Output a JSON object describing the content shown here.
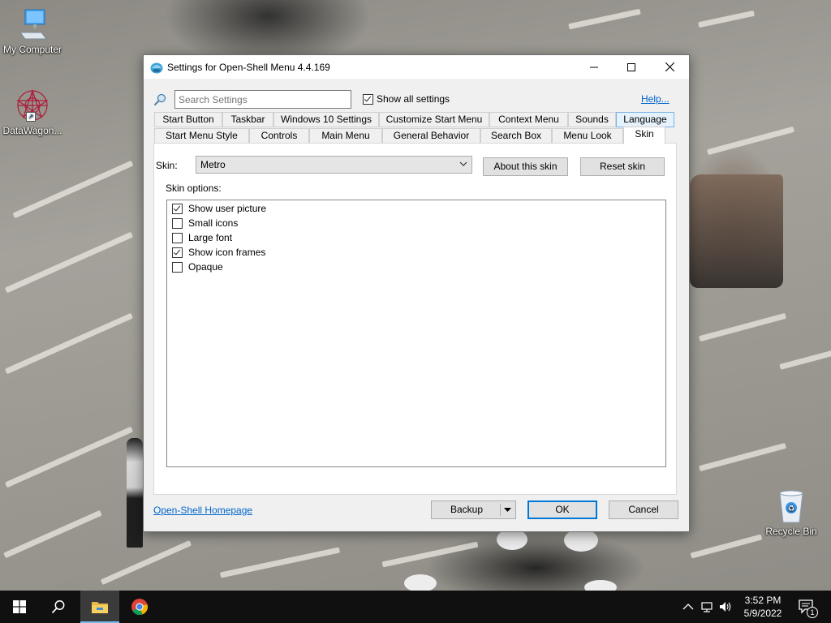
{
  "desktop": {
    "icons": [
      {
        "label": "My Computer"
      },
      {
        "label": "DataWagon..."
      },
      {
        "label": "Recycle Bin"
      }
    ]
  },
  "window": {
    "title": "Settings for Open-Shell Menu 4.4.169",
    "search_placeholder": "Search Settings",
    "show_all_label": "Show all settings",
    "show_all_checked": true,
    "help_label": "Help...",
    "tabs_row1": [
      "Start Button",
      "Taskbar",
      "Windows 10 Settings",
      "Customize Start Menu",
      "Context Menu",
      "Sounds",
      "Language"
    ],
    "tabs_row2": [
      "Start Menu Style",
      "Controls",
      "Main Menu",
      "General Behavior",
      "Search Box",
      "Menu Look",
      "Skin"
    ],
    "active_tab": "Skin",
    "skin": {
      "label": "Skin:",
      "selected": "Metro",
      "about_label": "About this skin",
      "reset_label": "Reset skin",
      "options_label": "Skin options:",
      "options": [
        {
          "label": "Show user picture",
          "checked": true
        },
        {
          "label": "Small icons",
          "checked": false
        },
        {
          "label": "Large font",
          "checked": false
        },
        {
          "label": "Show icon frames",
          "checked": true
        },
        {
          "label": "Opaque",
          "checked": false
        }
      ]
    },
    "footer": {
      "homepage_label": "Open-Shell Homepage",
      "backup_label": "Backup",
      "ok_label": "OK",
      "cancel_label": "Cancel"
    }
  },
  "taskbar": {
    "time": "3:52 PM",
    "date": "5/9/2022",
    "notification_count": "1"
  },
  "colors": {
    "accent": "#0078d7",
    "link": "#0066cc",
    "taskbar": "#101010"
  }
}
